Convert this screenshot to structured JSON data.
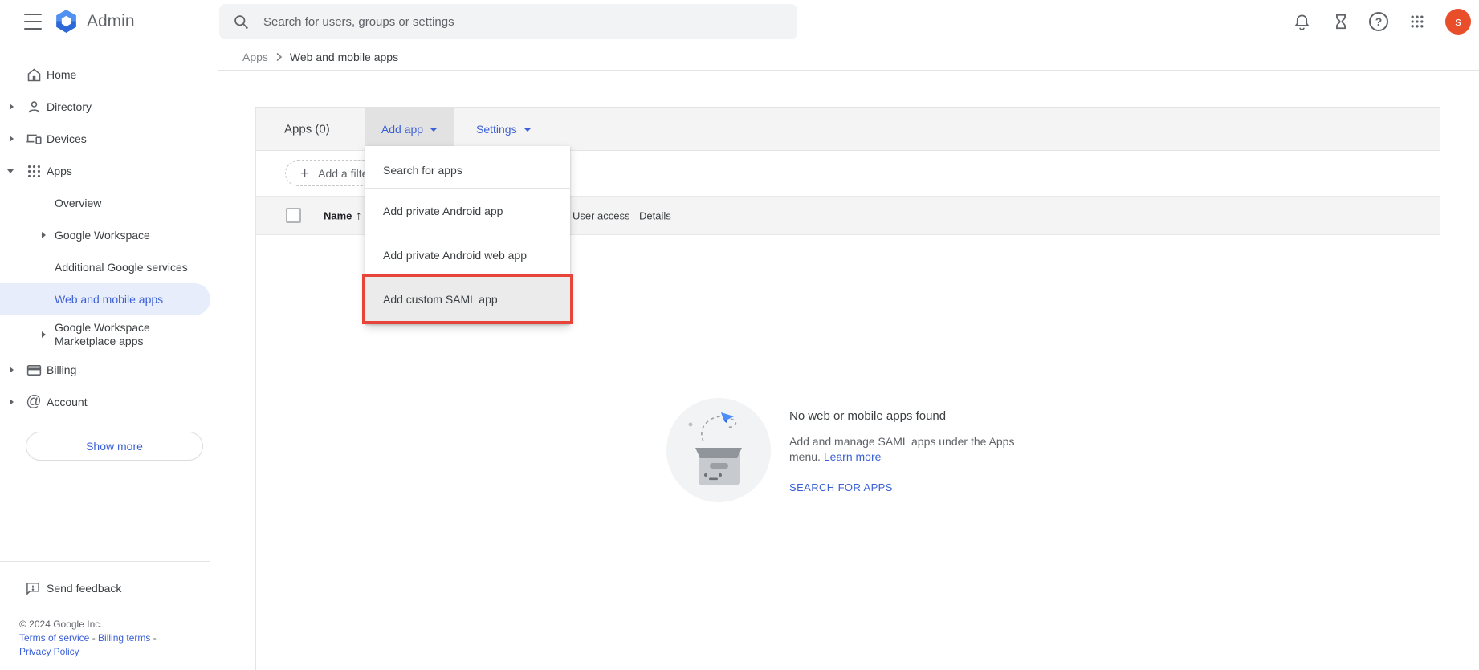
{
  "topbar": {
    "brand": "Admin",
    "search_placeholder": "Search for users, groups or settings",
    "avatar_initial": "s"
  },
  "breadcrumb": {
    "parent": "Apps",
    "current": "Web and mobile apps"
  },
  "sidebar": {
    "items": [
      {
        "label": "Home"
      },
      {
        "label": "Directory"
      },
      {
        "label": "Devices"
      },
      {
        "label": "Apps"
      },
      {
        "label": "Overview"
      },
      {
        "label": "Google Workspace"
      },
      {
        "label": "Additional Google services"
      },
      {
        "label": "Web and mobile apps"
      },
      {
        "label": "Google Workspace Marketplace apps"
      },
      {
        "label": "Billing"
      },
      {
        "label": "Account"
      }
    ],
    "show_more": "Show more",
    "send_feedback": "Send feedback",
    "copyright": "© 2024 Google Inc.",
    "legal_links": [
      "Terms of service",
      "Billing terms",
      "Privacy Policy"
    ],
    "legal_separator": "-"
  },
  "toolbar": {
    "title": "Apps (0)",
    "add_app": "Add app",
    "settings": "Settings"
  },
  "filter_bar": {
    "add_filter": "Add a filter"
  },
  "table": {
    "columns": [
      "Name",
      "User access",
      "Details"
    ]
  },
  "add_app_menu": {
    "items": [
      "Search for apps",
      "Add private Android app",
      "Add private Android web app",
      "Add custom SAML app"
    ],
    "highlighted_item": "Add custom SAML app"
  },
  "empty_state": {
    "title": "No web or mobile apps found",
    "description_line1": "Add and manage SAML apps under the Apps",
    "description_line2": "menu.",
    "learn_more": "Learn more",
    "cta": "SEARCH FOR APPS"
  },
  "icons": {
    "plus": "+",
    "sort_ascending": "↑",
    "at_symbol": "@",
    "question_mark": "?"
  },
  "colors": {
    "accent_blue": "#3c61d6",
    "selected_nav_bg": "#e7edfb",
    "annotation_red": "#e8453a",
    "avatar_orange": "#e94e2a",
    "muted_gray": "#5f6368"
  }
}
